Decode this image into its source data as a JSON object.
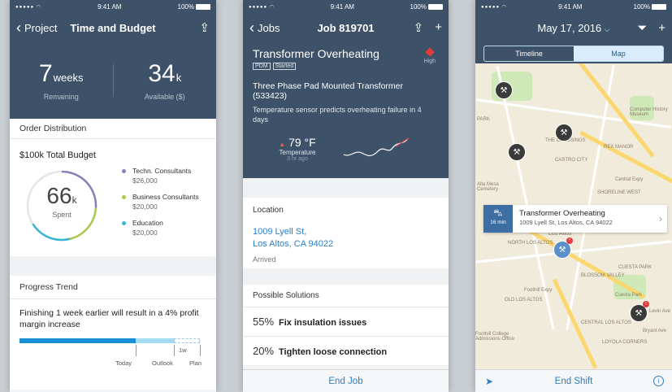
{
  "status": {
    "signal": "●●●●● ◠",
    "time": "9:41 AM",
    "battery": "100%"
  },
  "screen1": {
    "back_label": "Project",
    "title": "Time and Budget",
    "stat_weeks_value": "7",
    "stat_weeks_unit": "weeks",
    "stat_weeks_label": "Remaining",
    "stat_available_value": "34",
    "stat_available_unit": "k",
    "stat_available_label": "Available ($)",
    "order_heading": "Order Distribution",
    "budget_title": "$100k Total Budget",
    "donut_value": "66",
    "donut_unit": "k",
    "donut_label": "Spent",
    "legend": [
      {
        "name": "Techn. Consultants",
        "amount": "$26,000",
        "color": "#8a7fb8"
      },
      {
        "name": "Business Consultants",
        "amount": "$20,000",
        "color": "#a8c94a"
      },
      {
        "name": "Education",
        "amount": "$20,000",
        "color": "#3bb3d6"
      }
    ],
    "trend_heading": "Progress Trend",
    "trend_text": "Finishing 1 week earlier will result in a 4% profit margin increase",
    "tick_1w": "1w",
    "tick_today": "Today",
    "tick_outlook": "Outlook",
    "tick_plan": "Plan",
    "colors": {
      "header": "#3d5268",
      "accent": "#1a8fd6"
    }
  },
  "screen2": {
    "back_label": "Jobs",
    "title": "Job 819701",
    "job_title": "Transformer Overheating",
    "tag1": "PDM",
    "tag2": "Started",
    "priority": "High",
    "asset": "Three Phase Pad Mounted Transformer (533423)",
    "description": "Temperature sensor predicts overheating failure in 4 days",
    "temp_value": "79 °F",
    "temp_arrow": "▲",
    "temp_label": "Temperature",
    "temp_ago": "3 hr ago",
    "location_heading": "Location",
    "address_line1": "1009 Lyell St,",
    "address_line2": "Los Altos, CA 94022",
    "arrived": "Arrived",
    "solutions_heading": "Possible Solutions",
    "solutions": [
      {
        "pct": "55%",
        "text": "Fix insulation issues"
      },
      {
        "pct": "20%",
        "text": "Tighten loose connection"
      }
    ],
    "end_job": "End Job"
  },
  "screen3": {
    "date": "May 17, 2016",
    "tab_timeline": "Timeline",
    "tab_map": "Map",
    "callout_eta": "16 min",
    "callout_title": "Transformer Overheating",
    "callout_address": "1009 Lyell St, Los Altos, CA 94022",
    "end_shift": "End Shift",
    "map_labels": [
      "Los Altos",
      "NORTH LOS ALTOS",
      "CASTRO CITY",
      "THE CROSSINGS",
      "REX MANOR",
      "SHORELINE WEST",
      "CUESTA PARK",
      "BLOSSOM VALLEY",
      "OLD LOS ALTOS",
      "CENTRAL LOS ALTOS",
      "LOYOLA CORNERS",
      "Computer History Museum",
      "Cuesta Park",
      "Central Expy",
      "Foothill Expy",
      "Alta Mesa Cemetery",
      "Foothill College Admissions Office",
      "Bryant Ave",
      "Levin Ave",
      "PARK"
    ]
  }
}
